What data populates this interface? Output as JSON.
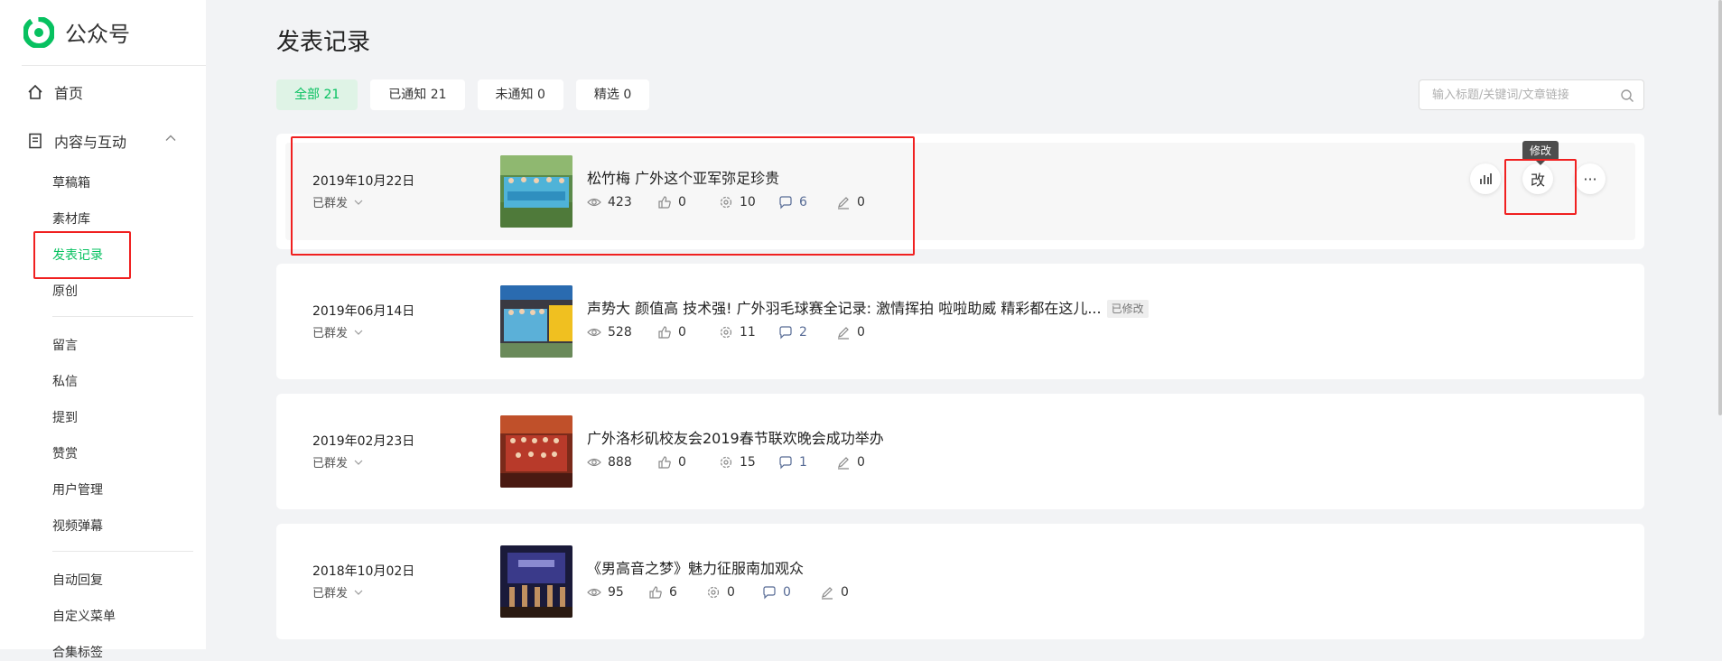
{
  "app": {
    "name": "公众号"
  },
  "sidebar": {
    "home": "首页",
    "content_section": "内容与互动",
    "group1": [
      "草稿箱",
      "素材库",
      "发表记录",
      "原创"
    ],
    "group2": [
      "留言",
      "私信",
      "提到",
      "赞赏",
      "用户管理",
      "视频弹幕"
    ],
    "group3": [
      "自动回复",
      "自定义菜单",
      "合集标签"
    ],
    "active": "发表记录"
  },
  "page": {
    "title": "发表记录"
  },
  "filters": [
    {
      "label": "全部 21",
      "active": true
    },
    {
      "label": "已通知 21",
      "active": false
    },
    {
      "label": "未通知 0",
      "active": false
    },
    {
      "label": "精选 0",
      "active": false
    }
  ],
  "search": {
    "placeholder": "输入标题/关键词/文章链接"
  },
  "articles": [
    {
      "date": "2019年10月22日",
      "status": "已群发",
      "title": "松竹梅 广外这个亚军弥足珍贵",
      "badge": "",
      "views": "423",
      "likes": "0",
      "shares": "10",
      "comments": "6",
      "edits": "0"
    },
    {
      "date": "2019年06月14日",
      "status": "已群发",
      "title": "声势大 颜值高 技术强! 广外羽毛球赛全记录: 激情挥拍 啦啦助威 精彩都在这儿...",
      "badge": "已修改",
      "views": "528",
      "likes": "0",
      "shares": "11",
      "comments": "2",
      "edits": "0"
    },
    {
      "date": "2019年02月23日",
      "status": "已群发",
      "title": "广外洛杉矶校友会2019春节联欢晚会成功举办",
      "badge": "",
      "views": "888",
      "likes": "0",
      "shares": "15",
      "comments": "1",
      "edits": "0"
    },
    {
      "date": "2018年10月02日",
      "status": "已群发",
      "title": "《男高音之梦》魅力征服南加观众",
      "badge": "",
      "views": "95",
      "likes": "6",
      "shares": "0",
      "comments": "0",
      "edits": "0"
    }
  ],
  "actions": {
    "edit_label": "改",
    "more_label": "···",
    "tooltip": "修改"
  },
  "colors": {
    "accent": "#07c160",
    "link": "#576b95",
    "annotation": "#f02020"
  }
}
